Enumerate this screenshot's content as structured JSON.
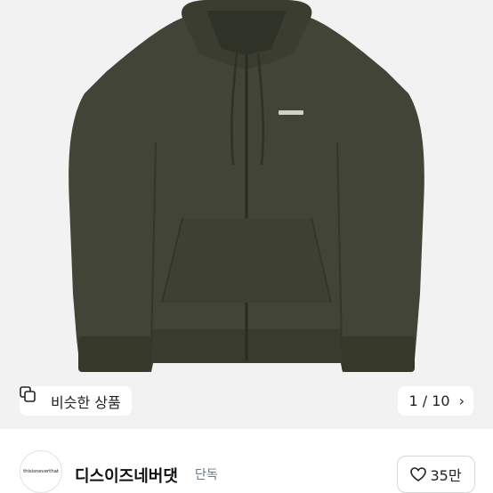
{
  "product": {
    "image_alt": "Olive green zip-up hoodie"
  },
  "similar": {
    "label": "비슷한 상품",
    "icon": "similar-items-icon"
  },
  "gallery": {
    "counter": "1 / 10",
    "next_icon": "chevron-right-icon"
  },
  "seller": {
    "avatar_text": "thisisneverthat",
    "name": "디스이즈네버댓",
    "badge": "단독"
  },
  "like": {
    "count": "35만",
    "icon": "heart-icon"
  },
  "colors": {
    "hoodie": "#414436",
    "hoodie_dark": "#343629",
    "background": "#f2f2f2"
  }
}
